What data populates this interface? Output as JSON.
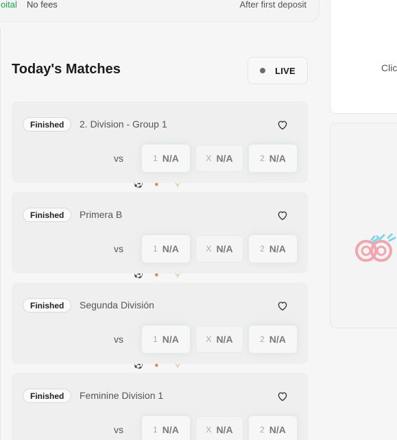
{
  "promo": {
    "left_text": "oital",
    "fees_text": "No fees",
    "right_text": "After first deposit"
  },
  "header": {
    "title": "Today's Matches",
    "live_label": "LIVE"
  },
  "matches": [
    {
      "status": "Finished",
      "league": "2. Division - Group 1",
      "vs": "vs",
      "odds": [
        {
          "key": "1",
          "value": "N/A"
        },
        {
          "key": "X",
          "value": "N/A"
        },
        {
          "key": "2",
          "value": "N/A"
        }
      ]
    },
    {
      "status": "Finished",
      "league": "Primera B",
      "vs": "vs",
      "odds": [
        {
          "key": "1",
          "value": "N/A"
        },
        {
          "key": "X",
          "value": "N/A"
        },
        {
          "key": "2",
          "value": "N/A"
        }
      ]
    },
    {
      "status": "Finished",
      "league": "Segunda División",
      "vs": "vs",
      "odds": [
        {
          "key": "1",
          "value": "N/A"
        },
        {
          "key": "X",
          "value": "N/A"
        },
        {
          "key": "2",
          "value": "N/A"
        }
      ]
    },
    {
      "status": "Finished",
      "league": "Feminine Division 1",
      "vs": "vs",
      "odds": [
        {
          "key": "1",
          "value": "N/A"
        },
        {
          "key": "X",
          "value": "N/A"
        },
        {
          "key": "2",
          "value": "N/A"
        }
      ]
    }
  ],
  "sport_icons": [
    "soccer-ball-icon",
    "basketball-icon",
    "tennis-racket-icon"
  ],
  "right_panel": {
    "top_text": "Clic"
  },
  "colors": {
    "accent_green": "#16a34a",
    "logo_pink": "#f2a5ac",
    "logo_cyan": "#7fd6e8"
  }
}
